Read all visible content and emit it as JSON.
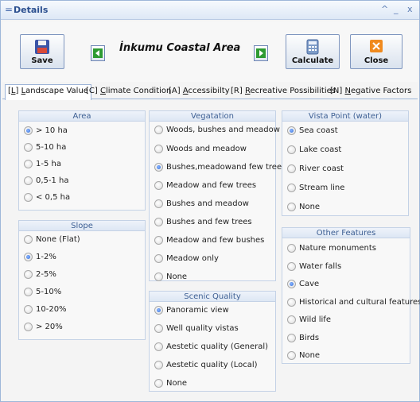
{
  "window": {
    "title": "Details",
    "menu_glyph": "=",
    "btn_up": "^",
    "btn_min": "_",
    "btn_close": "x"
  },
  "toolbar": {
    "save": "Save",
    "calculate": "Calculate",
    "close": "Close",
    "area_title": "İnkumu Coastal Area",
    "icons": {
      "save": "floppy-disk-icon",
      "calculate": "calculator-icon",
      "close": "close-x-icon",
      "prev": "arrow-left-icon",
      "next": "arrow-right-icon"
    },
    "colors": {
      "arrow_green": "#2e9b32",
      "close_orange": "#f08a1e",
      "save_blue": "#3b55a8"
    }
  },
  "tabs": [
    {
      "key": "[L]",
      "letter": "L",
      "rest": "andscape Value",
      "active": true
    },
    {
      "key": "[C]",
      "letter": "C",
      "rest": "limate Condition",
      "active": false
    },
    {
      "key": "[A]",
      "letter": "A",
      "rest": "ccessibilty",
      "active": false
    },
    {
      "key": "[R]",
      "letter": "R",
      "rest": "ecreative Possibilities",
      "active": false
    },
    {
      "key": "[N]",
      "letter": "N",
      "rest": "egative Factors",
      "active": false
    }
  ],
  "groups": {
    "area": {
      "title": "Area",
      "options": [
        {
          "label": "> 10 ha",
          "selected": true
        },
        {
          "label": "5-10 ha",
          "selected": false
        },
        {
          "label": "1-5 ha",
          "selected": false
        },
        {
          "label": "0,5-1 ha",
          "selected": false
        },
        {
          "label": "< 0,5 ha",
          "selected": false
        }
      ]
    },
    "slope": {
      "title": "Slope",
      "options": [
        {
          "label": "None (Flat)",
          "selected": false
        },
        {
          "label": "1-2%",
          "selected": true
        },
        {
          "label": "2-5%",
          "selected": false
        },
        {
          "label": "5-10%",
          "selected": false
        },
        {
          "label": "10-20%",
          "selected": false
        },
        {
          "label": "> 20%",
          "selected": false
        }
      ]
    },
    "vegetation": {
      "title": "Vegatation",
      "options": [
        {
          "label": "Woods, bushes and meadow",
          "selected": false
        },
        {
          "label": "Woods and meadow",
          "selected": false
        },
        {
          "label": "Bushes,meadowand few trees",
          "selected": true
        },
        {
          "label": "Meadow and few trees",
          "selected": false
        },
        {
          "label": "Bushes and meadow",
          "selected": false
        },
        {
          "label": "Bushes and few trees",
          "selected": false
        },
        {
          "label": "Meadow and few bushes",
          "selected": false
        },
        {
          "label": "Meadow only",
          "selected": false
        },
        {
          "label": "None",
          "selected": false
        }
      ]
    },
    "scenic": {
      "title": "Scenic Quality",
      "options": [
        {
          "label": "Panoramic view",
          "selected": true
        },
        {
          "label": "Well quality vistas",
          "selected": false
        },
        {
          "label": "Aestetic quality (General)",
          "selected": false
        },
        {
          "label": "Aestetic quality (Local)",
          "selected": false
        },
        {
          "label": "None",
          "selected": false
        }
      ]
    },
    "vista": {
      "title": "Vista Point (water)",
      "options": [
        {
          "label": "Sea coast",
          "selected": true
        },
        {
          "label": "Lake coast",
          "selected": false
        },
        {
          "label": "River coast",
          "selected": false
        },
        {
          "label": "Stream line",
          "selected": false
        },
        {
          "label": "None",
          "selected": false
        }
      ]
    },
    "other": {
      "title": "Other Features",
      "options": [
        {
          "label": "Nature monuments",
          "selected": false
        },
        {
          "label": "Water falls",
          "selected": false
        },
        {
          "label": "Cave",
          "selected": true
        },
        {
          "label": "Historical and cultural features",
          "selected": false
        },
        {
          "label": "Wild life",
          "selected": false
        },
        {
          "label": "Birds",
          "selected": false
        },
        {
          "label": "None",
          "selected": false
        }
      ]
    }
  }
}
